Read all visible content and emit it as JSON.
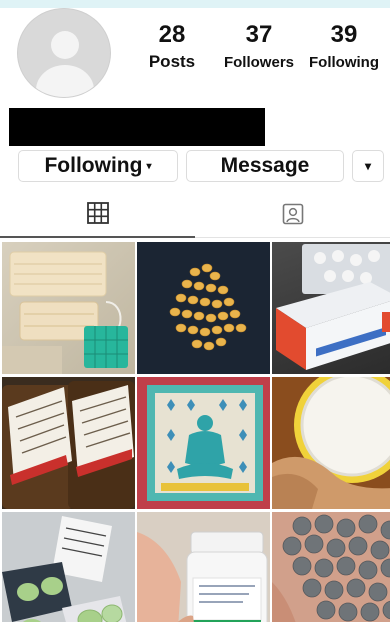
{
  "profile": {
    "stats": [
      {
        "value": "28",
        "label": "Posts"
      },
      {
        "value": "37",
        "label": "Followers"
      },
      {
        "value": "39",
        "label": "Following"
      }
    ]
  },
  "actions": {
    "following_label": "Following",
    "message_label": "Message"
  },
  "tabs": [
    {
      "icon": "grid-icon",
      "active": true
    },
    {
      "icon": "tagged-icon",
      "active": false
    }
  ],
  "colors": {
    "accent": "#111111",
    "border": "#dcdcdc",
    "redaction": "#000000"
  },
  "posts": [
    {
      "icon": "face-masks-photo"
    },
    {
      "icon": "pills-photo"
    },
    {
      "icon": "medicine-boxes-photo"
    },
    {
      "icon": "medicine-bottles-photo"
    },
    {
      "icon": "meditation-art-photo"
    },
    {
      "icon": "powder-jar-photo"
    },
    {
      "icon": "blister-pack-photo"
    },
    {
      "icon": "pill-bottle-photo"
    },
    {
      "icon": "tablets-pile-photo"
    }
  ]
}
